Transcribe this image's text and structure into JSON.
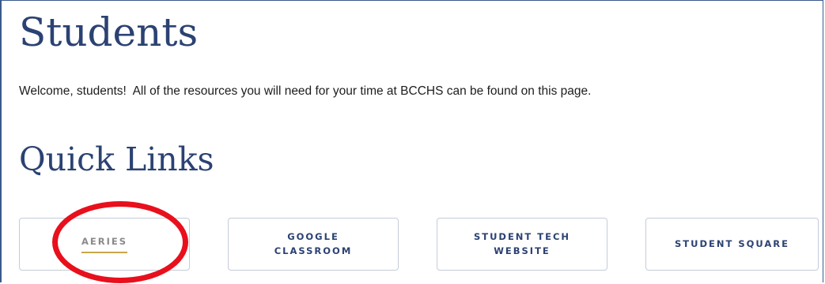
{
  "page": {
    "title": "Students",
    "welcome_text": "Welcome, students!  All of the resources you will need for your time at BCCHS can be found on this page."
  },
  "quick_links": {
    "heading": "Quick Links",
    "links": [
      {
        "label": "AERIES"
      },
      {
        "label": "GOOGLE CLASSROOM"
      },
      {
        "label": "STUDENT TECH WEBSITE"
      },
      {
        "label": "STUDENT SQUARE"
      }
    ]
  },
  "colors": {
    "heading": "#2b4272",
    "card_border": "#c5ccd8",
    "active_underline": "#c9a64a",
    "highlight_ring": "#e8101c"
  }
}
